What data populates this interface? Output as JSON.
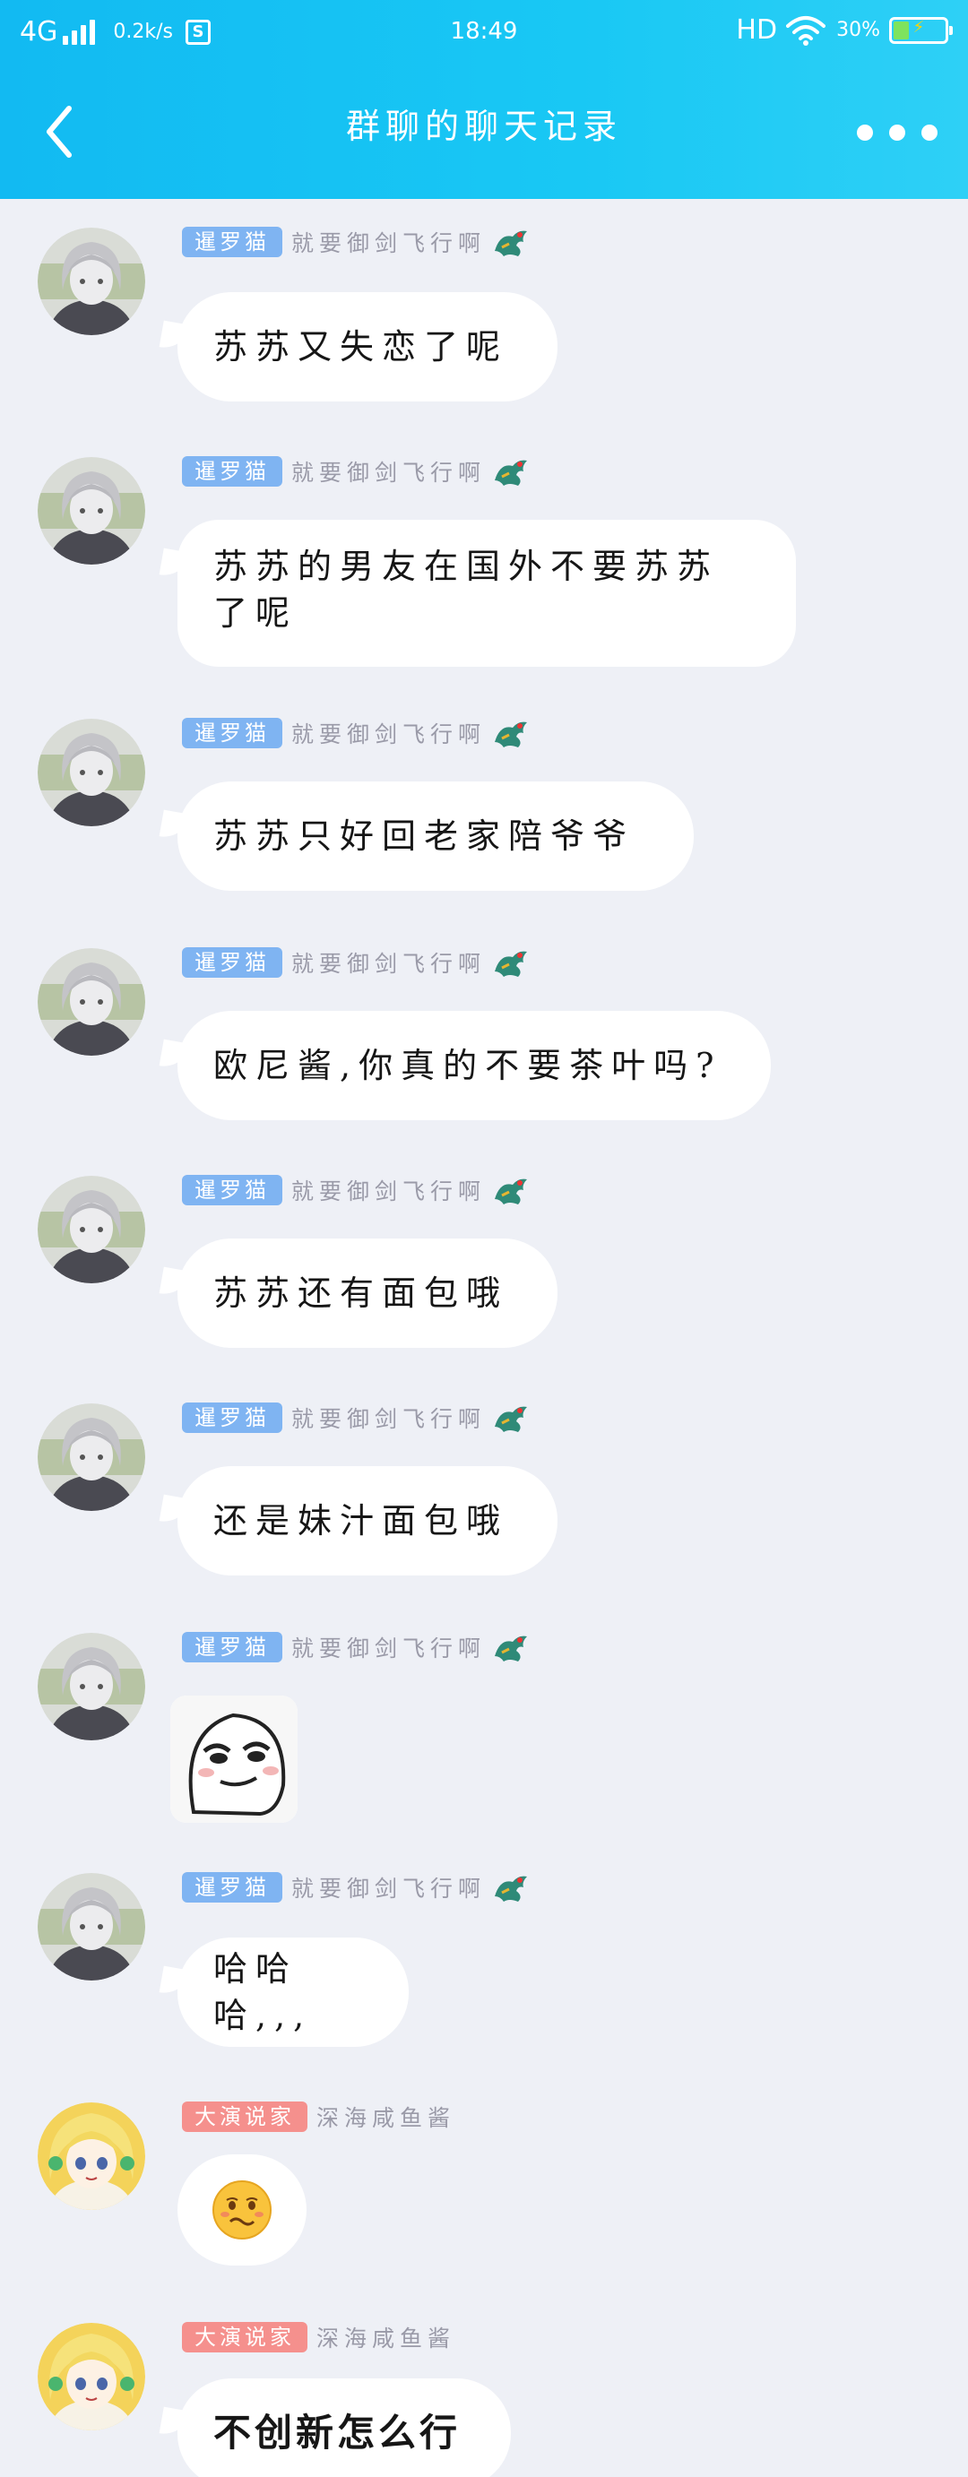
{
  "status_bar": {
    "network": "4G",
    "speed": "0.2k/s",
    "s_icon": "S",
    "time": "18:49",
    "hd": "HD",
    "battery": "30%",
    "battery_level": 0.3
  },
  "header": {
    "title": "群聊的聊天记录"
  },
  "colors": {
    "header_start": "#12baf2",
    "header_end": "#2ed0f6",
    "badge_blue": "#7fb4f2",
    "badge_red": "#f5908d",
    "background": "#eef0f6"
  },
  "icons": {
    "back": "chevron-left-icon",
    "more": "more-dots-icon",
    "wifi": "wifi-icon",
    "battery": "battery-icon",
    "dragon": "dragon-badge-icon"
  },
  "messages": [
    {
      "sender_title": "暹罗猫",
      "sender_name": "就要御剑飞行啊",
      "text": "苏苏又失恋了呢"
    },
    {
      "sender_title": "暹罗猫",
      "sender_name": "就要御剑飞行啊",
      "text_line1": "苏苏的男友在国外不要苏苏",
      "text_line2": "了呢"
    },
    {
      "sender_title": "暹罗猫",
      "sender_name": "就要御剑飞行啊",
      "text": "苏苏只好回老家陪爷爷"
    },
    {
      "sender_title": "暹罗猫",
      "sender_name": "就要御剑飞行啊",
      "text": "欧尼酱,你真的不要茶叶吗?"
    },
    {
      "sender_title": "暹罗猫",
      "sender_name": "就要御剑飞行啊",
      "text": "苏苏还有面包哦"
    },
    {
      "sender_title": "暹罗猫",
      "sender_name": "就要御剑飞行啊",
      "text": "还是妹汁面包哦"
    },
    {
      "sender_title": "暹罗猫",
      "sender_name": "就要御剑飞行啊",
      "sticker": "smirk-face-sticker"
    },
    {
      "sender_title": "暹罗猫",
      "sender_name": "就要御剑飞行啊",
      "text": "哈哈哈,,,"
    },
    {
      "sender_title": "大演说家",
      "sender_name": "深海咸鱼酱",
      "emoji": "awkward-emoji"
    },
    {
      "sender_title": "大演说家",
      "sender_name": "深海咸鱼酱",
      "text": "不创新怎么行"
    }
  ]
}
